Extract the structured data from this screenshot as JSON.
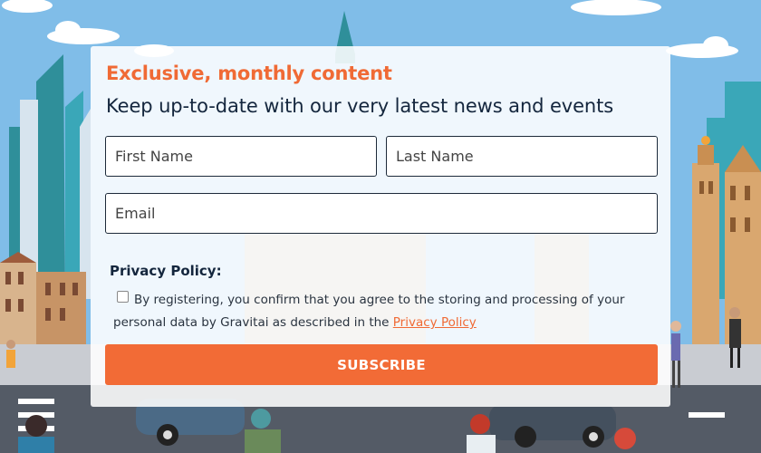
{
  "form": {
    "eyebrow": "Exclusive, monthly content",
    "headline": "Keep up-to-date with our very latest news and events",
    "first_name_placeholder": "First Name",
    "last_name_placeholder": "Last Name",
    "email_placeholder": "Email",
    "privacy_heading": "Privacy Policy:",
    "consent_text": "By registering, you confirm that you agree to the storing and processing of your personal data by Gravitai as described in the ",
    "privacy_link": "Privacy Policy",
    "consent_checked": false,
    "subscribe_label": "SUBSCRIBE"
  },
  "colors": {
    "accent": "#f26b36",
    "heading": "#14263d",
    "sky": "#7fbde8"
  },
  "icons": [
    "cloud-icon",
    "skyline-illustration",
    "checkbox-icon"
  ]
}
